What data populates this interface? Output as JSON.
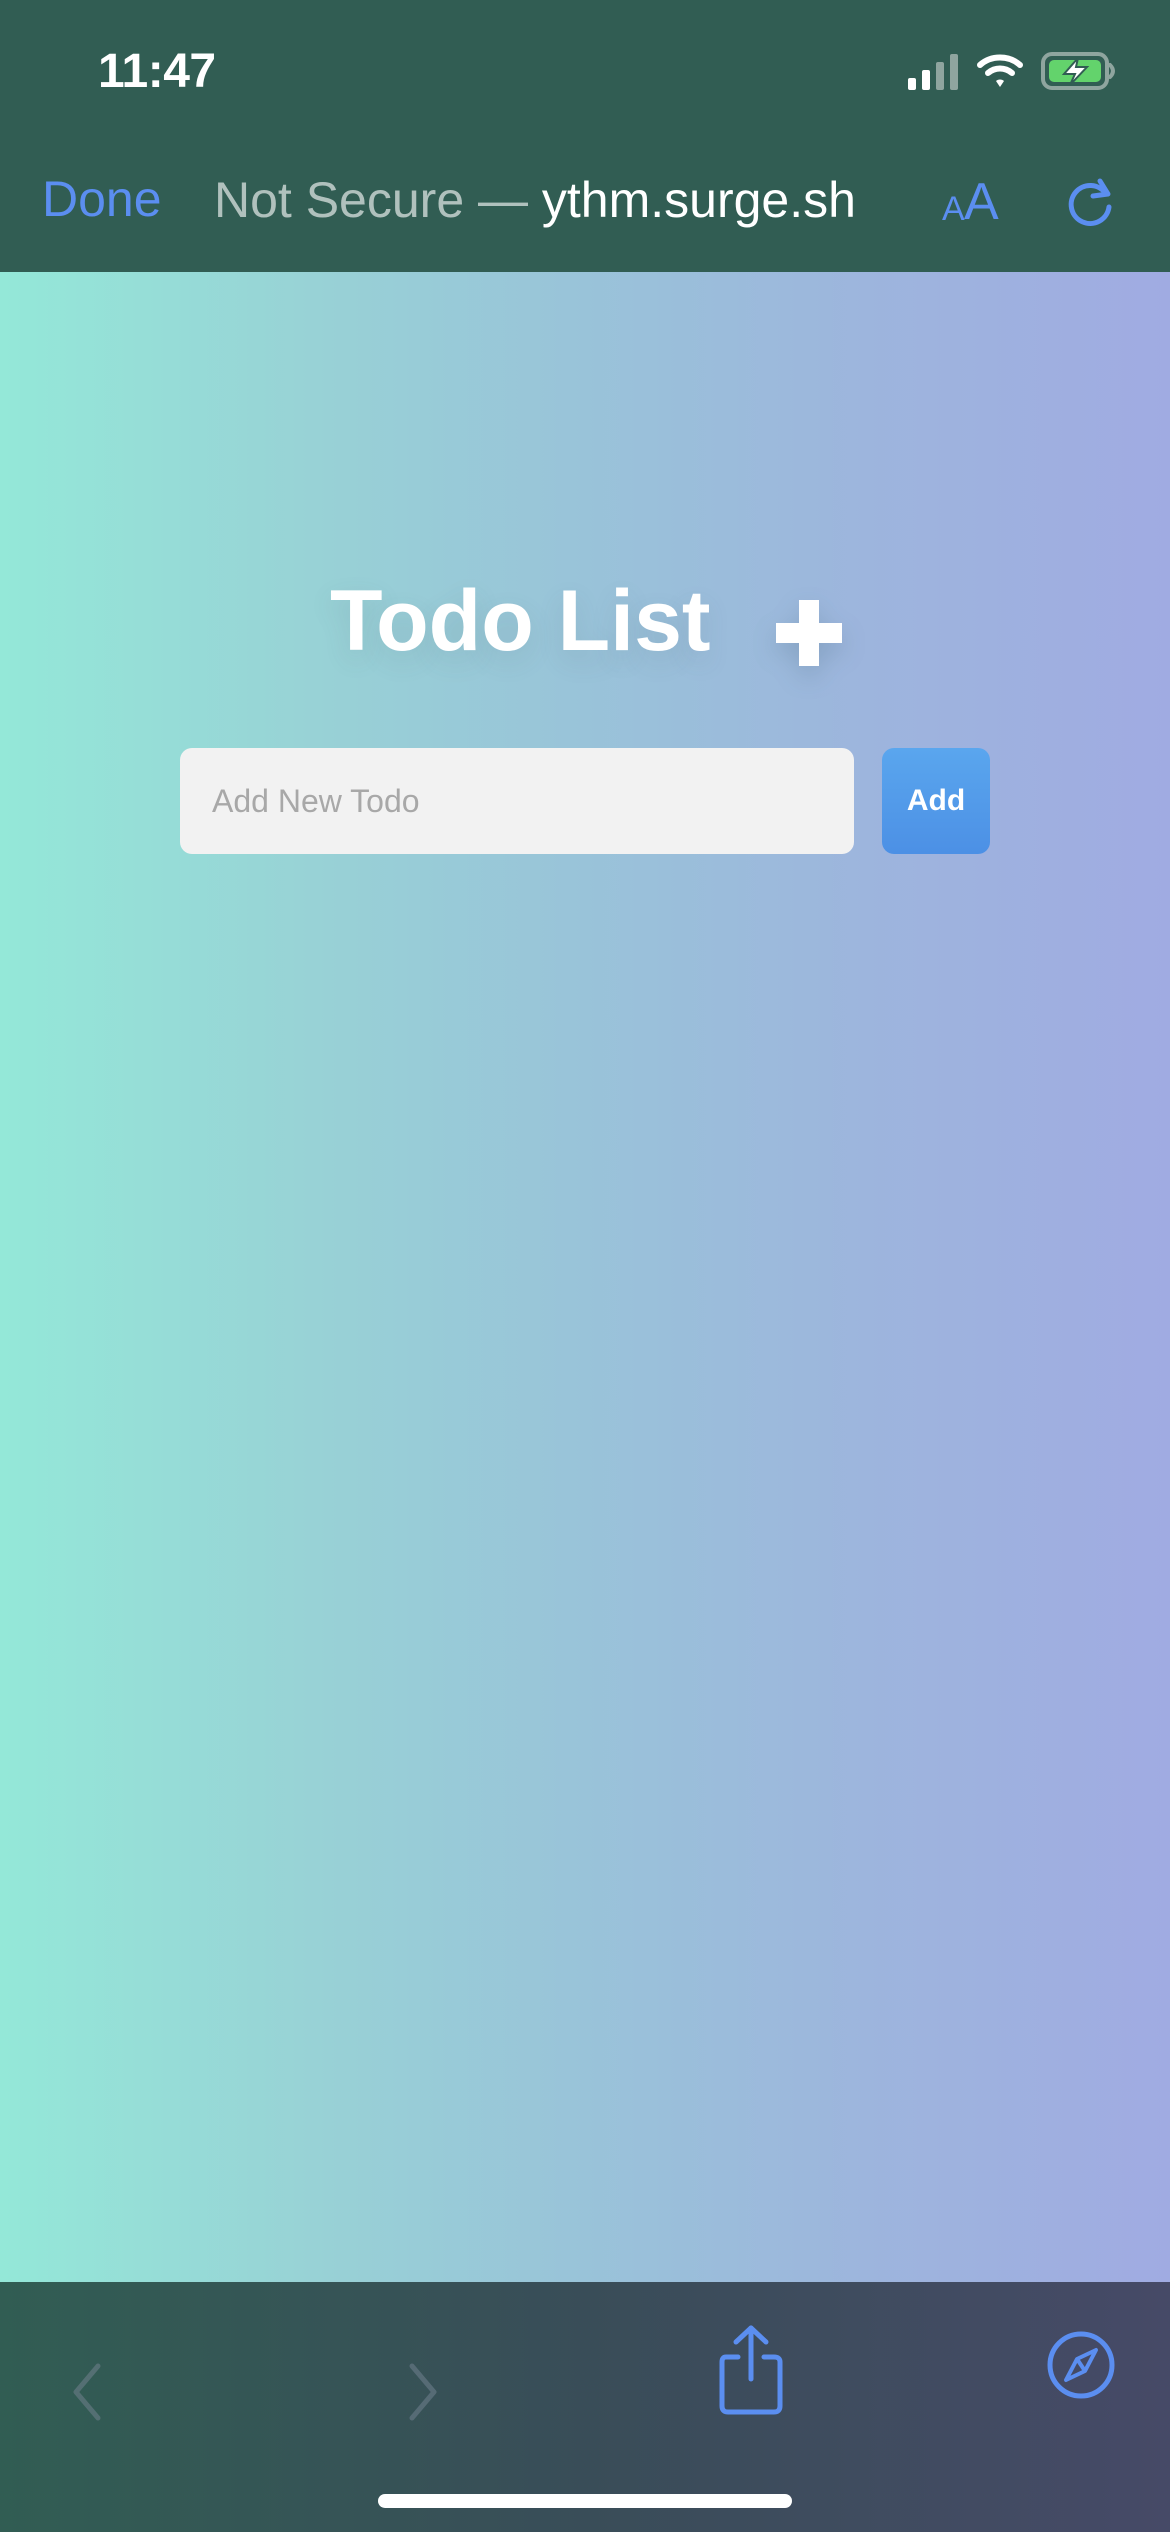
{
  "status_bar": {
    "time": "11:47",
    "icons": [
      "signal-icon",
      "wifi-icon",
      "battery-icon"
    ]
  },
  "browser": {
    "done_label": "Done",
    "url_prefix": "Not Secure — ",
    "url_host": "ythm.surge.sh",
    "text_size_small": "A",
    "text_size_large": "A",
    "reload_icon": "reload-icon"
  },
  "page": {
    "title": "Todo List",
    "plus_icon": "plus-icon",
    "input_placeholder": "Add New Todo",
    "input_value": "",
    "add_button_label": "Add"
  },
  "toolbar": {
    "back_icon": "back-icon",
    "forward_icon": "forward-icon",
    "share_icon": "share-icon",
    "compass_icon": "compass-icon"
  },
  "colors": {
    "browser_background": "#315d53",
    "safari_accent": "#5b8ef0",
    "page_gradient_start": "#94e8d8",
    "page_gradient_end": "#a0abe2",
    "add_button": "#4c90e5",
    "input_background": "#f2f2f2"
  }
}
